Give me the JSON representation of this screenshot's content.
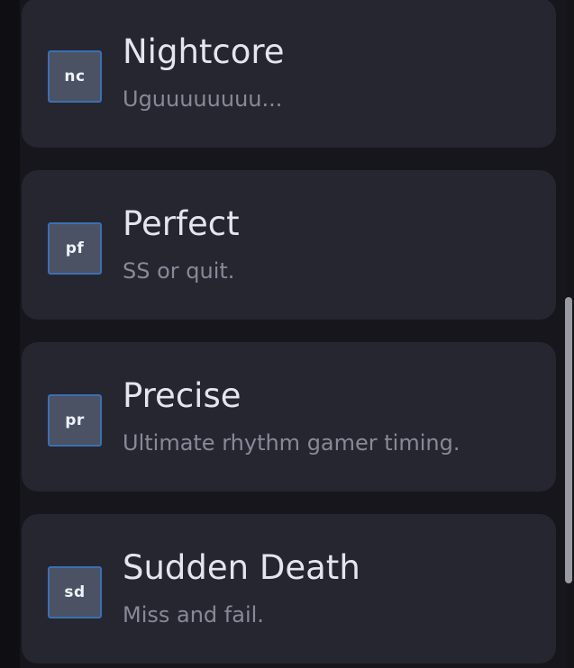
{
  "mods": [
    {
      "acronym": "nc",
      "icon": "nightcore-icon",
      "name": "Nightcore",
      "description": "Uguuuuuuuu..."
    },
    {
      "acronym": "pf",
      "icon": "perfect-icon",
      "name": "Perfect",
      "description": "SS or quit."
    },
    {
      "acronym": "pr",
      "icon": "precise-icon",
      "name": "Precise",
      "description": "Ultimate rhythm gamer timing."
    },
    {
      "acronym": "sd",
      "icon": "sudden-death-icon",
      "name": "Sudden Death",
      "description": "Miss and fail."
    }
  ],
  "colors": {
    "background": "#16161c",
    "card": "#262630",
    "icon_fill": "#4a5263",
    "icon_border": "#3c6fb4",
    "title_text": "#e4e6ee",
    "description_text": "#868a98",
    "scrollbar_thumb": "#9a9aa2"
  },
  "scroll": {
    "thumb_start_fraction": 0.445,
    "thumb_length_fraction": 0.429
  }
}
